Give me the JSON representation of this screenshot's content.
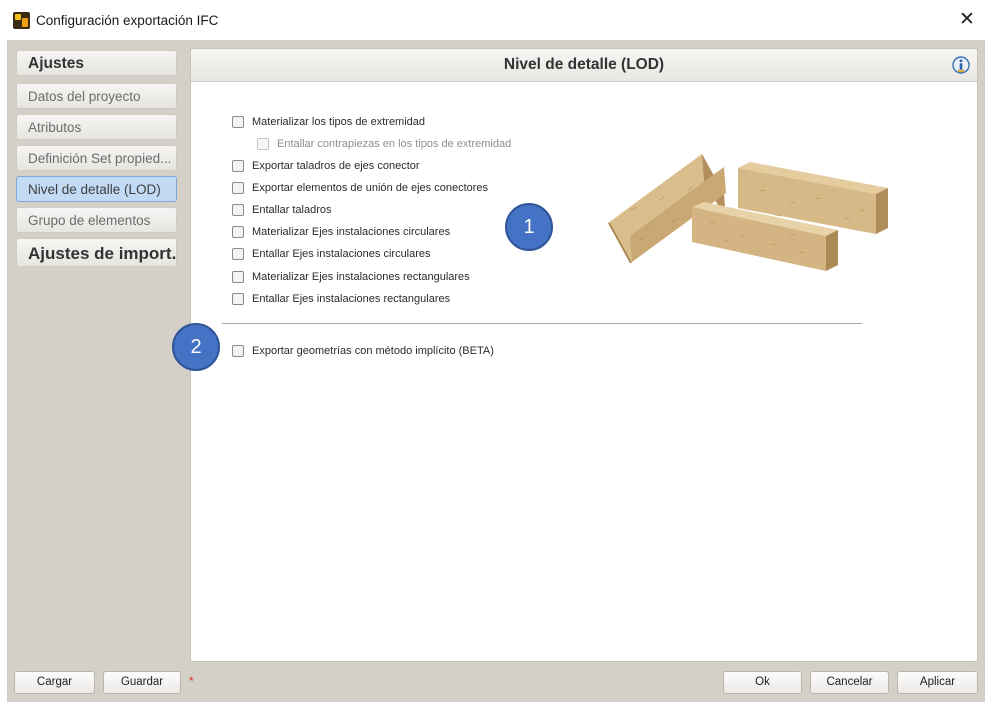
{
  "window": {
    "title": "Configuración exportación IFC",
    "close_glyph": "✕"
  },
  "sidebar": {
    "items": [
      {
        "label": "Ajustes"
      },
      {
        "label": "Datos del proyecto"
      },
      {
        "label": "Atributos"
      },
      {
        "label": "Definición Set propied..."
      },
      {
        "label": "Nivel de detalle (LOD)"
      },
      {
        "label": "Grupo de elementos"
      },
      {
        "label": "Ajustes de import..."
      }
    ],
    "active_index": 4
  },
  "panel": {
    "title": "Nivel de detalle (LOD)",
    "info_icon": "info-icon",
    "options": [
      {
        "label": "Materializar los tipos de extremidad",
        "checked": false
      },
      {
        "label": "Entallar contrapiezas en los tipos de extremidad",
        "checked": false,
        "disabled": true
      },
      {
        "label": "Exportar taladros de ejes conector",
        "checked": false
      },
      {
        "label": "Exportar elementos de unión de ejes conectores",
        "checked": false
      },
      {
        "label": "Entallar taladros",
        "checked": false
      },
      {
        "label": "Materializar Ejes instalaciones circulares",
        "checked": false
      },
      {
        "label": "Entallar Ejes instalaciones circulares",
        "checked": false
      },
      {
        "label": "Materializar Ejes instalaciones rectangulares",
        "checked": false
      },
      {
        "label": "Entallar Ejes instalaciones rectangulares",
        "checked": false
      }
    ],
    "beta_option": {
      "label": "Exportar geometrías con método implícito (BETA)",
      "checked": false
    },
    "badges": [
      "1",
      "2"
    ]
  },
  "footer": {
    "load_label": "Cargar",
    "save_label": "Guardar",
    "modified_marker": "*",
    "ok_label": "Ok",
    "cancel_label": "Cancelar",
    "apply_label": "Aplicar"
  },
  "colors": {
    "frame": "#d4d0c8",
    "active_nav": "#c2daf4",
    "badge": "#4472c4",
    "wood": "#d8b987"
  }
}
